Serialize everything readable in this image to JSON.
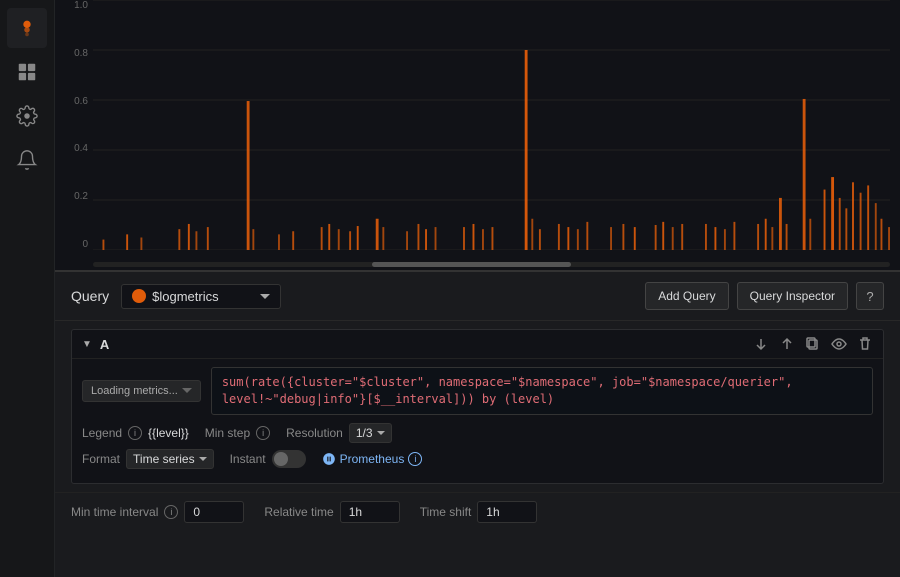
{
  "sidebar": {
    "icons": [
      {
        "name": "explore-icon",
        "label": "Explore",
        "active": true
      },
      {
        "name": "dashboard-icon",
        "label": "Dashboard",
        "active": false
      },
      {
        "name": "settings-icon",
        "label": "Settings",
        "active": false
      },
      {
        "name": "alert-icon",
        "label": "Alerts",
        "active": false
      }
    ]
  },
  "chart": {
    "y_labels": [
      "1.0",
      "0.8",
      "0.6",
      "0.4",
      "0.2",
      "0"
    ]
  },
  "query_header": {
    "label": "Query",
    "datasource_name": "$logmetrics",
    "add_query_btn": "Add Query",
    "inspector_btn": "Query Inspector",
    "help_btn": "?"
  },
  "query_block": {
    "letter": "A",
    "metric_selector_label": "Loading metrics...",
    "expression": "sum(rate({cluster=\"$cluster\", namespace=\"$namespace\", job=\"$namespace/querier\", level!~\"debug|info\"}[$__interval])) by (level)",
    "legend_label": "Legend",
    "legend_value": "{{level}}",
    "min_step_label": "Min step",
    "resolution_label": "Resolution",
    "resolution_value": "1/3",
    "format_label": "Format",
    "format_value": "Time series",
    "instant_label": "Instant",
    "prometheus_label": "Prometheus"
  },
  "bottom": {
    "min_time_label": "Min time interval",
    "min_time_value": "0",
    "relative_time_label": "Relative time",
    "relative_time_value": "1h",
    "time_shift_label": "Time shift",
    "time_shift_value": "1h"
  }
}
